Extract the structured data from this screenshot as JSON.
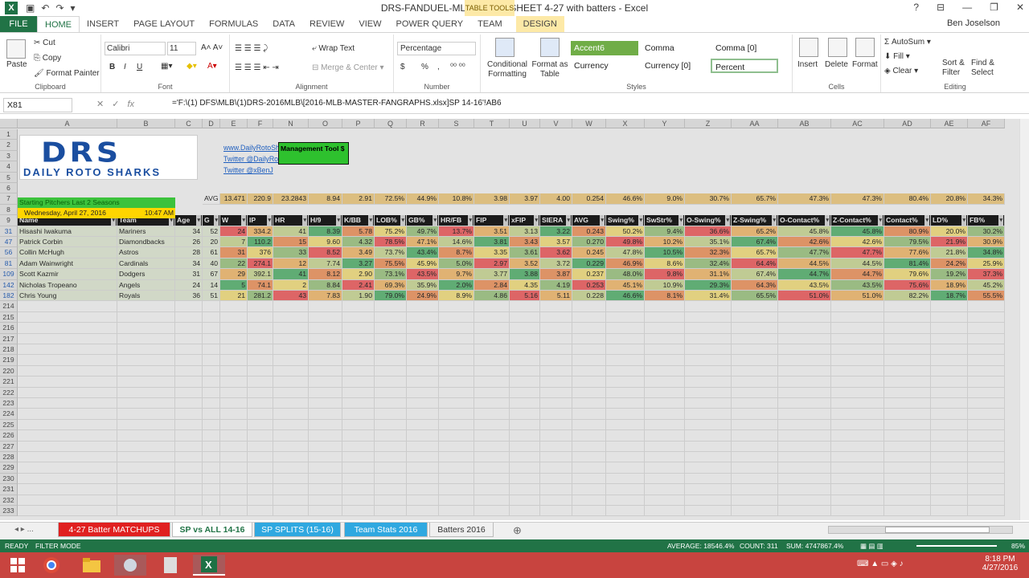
{
  "window": {
    "title": "DRS-FANDUEL-MLB-CHEAT-SHEET 4-27 with batters - Excel",
    "table_tools": "TABLE TOOLS",
    "user": "Ben Joselson",
    "controls": [
      "?",
      "⊟",
      "—",
      "❐",
      "✕"
    ]
  },
  "ribbon_tabs": [
    "FILE",
    "HOME",
    "INSERT",
    "PAGE LAYOUT",
    "FORMULAS",
    "DATA",
    "REVIEW",
    "VIEW",
    "POWER QUERY",
    "TEAM",
    "DESIGN"
  ],
  "clipboard": {
    "paste": "Paste",
    "cut": "Cut",
    "copy": "Copy",
    "format_painter": "Format Painter",
    "label": "Clipboard"
  },
  "font": {
    "name": "Calibri",
    "size": "11",
    "label": "Font",
    "bold": "B",
    "italic": "I",
    "underline": "U"
  },
  "alignment": {
    "wrap": "Wrap Text",
    "merge": "Merge & Center",
    "label": "Alignment"
  },
  "number": {
    "format": "Percentage",
    "label": "Number",
    "currency": "$",
    "percent": "%",
    "comma": ","
  },
  "styles": {
    "conditional": "Conditional Formatting",
    "format_as_table": "Format as Table",
    "cells": [
      "Accent6",
      "Comma",
      "Comma [0]",
      "Currency",
      "Currency [0]",
      "Percent"
    ],
    "label": "Styles"
  },
  "cells_group": {
    "insert": "Insert",
    "delete": "Delete",
    "format": "Format",
    "label": "Cells"
  },
  "editing": {
    "autosum": "AutoSum",
    "fill": "Fill",
    "clear": "Clear",
    "sort": "Sort & Filter",
    "find": "Find & Select",
    "label": "Editing"
  },
  "formula_bar": {
    "name_box": "X81",
    "fx": "fx",
    "formula": "='F:\\(1) DFS\\MLB\\(1)DRS-2016MLB\\[2016-MLB-MASTER-FANGRAPHS.xlsx]SP 14-16'!AB6"
  },
  "columns": [
    "A",
    "B",
    "C",
    "D",
    "E",
    "F",
    "N",
    "O",
    "P",
    "Q",
    "R",
    "S",
    "T",
    "U",
    "V",
    "W",
    "X",
    "Y",
    "Z",
    "AA",
    "AB",
    "AC",
    "AD",
    "AE",
    "AF"
  ],
  "logo": {
    "big": "DRS",
    "sub": "DAILY ROTO SHARKS"
  },
  "links": [
    "www.DailyRotoSharks.com",
    "Twitter @DailyRotoSharks",
    "Twitter @xBenJ"
  ],
  "mgmt": "Management Tool $",
  "green_bar": "Starting Pitchers Last 2 Seasons",
  "date": {
    "day": "Wednesday, April 27, 2016",
    "time": "10:47 AM"
  },
  "avg_label": "AVG",
  "avg_values": [
    "13.471",
    "220.9",
    "23.2843",
    "8.94",
    "2.91",
    "72.5%",
    "44.9%",
    "10.8%",
    "3.98",
    "3.97",
    "4.00",
    "0.254",
    "46.6%",
    "9.0%",
    "30.7%",
    "65.7%",
    "47.3%",
    "47.3%",
    "80.4%",
    "20.8%",
    "34.3%"
  ],
  "headers": [
    "Name",
    "Team",
    "Age",
    "G",
    "W",
    "IP",
    "HR",
    "H/9",
    "K/BB",
    "LOB%",
    "GB%",
    "HR/FB",
    "FIP",
    "xFIP",
    "SIERA",
    "AVG",
    "Swing%",
    "SwStr%",
    "O-Swing%",
    "Z-Swing%",
    "O-Contact%",
    "Z-Contact%",
    "Contact%",
    "LD%",
    "FB%"
  ],
  "rows": [
    {
      "rn": "31",
      "cells": [
        "Hisashi Iwakuma",
        "Mariners",
        "34",
        "52",
        "24",
        "334.2",
        "41",
        "8.39",
        "5.78",
        "75.2%",
        "49.7%",
        "13.7%",
        "3.51",
        "3.13",
        "3.22",
        "0.243",
        "50.2%",
        "9.4%",
        "36.6%",
        "65.2%",
        "45.8%",
        "45.8%",
        "80.9%",
        "20.0%",
        "30.2%"
      ]
    },
    {
      "rn": "47",
      "cells": [
        "Patrick Corbin",
        "Diamondbacks",
        "26",
        "20",
        "7",
        "110.2",
        "15",
        "9.60",
        "4.32",
        "78.5%",
        "47.1%",
        "14.6%",
        "3.81",
        "3.43",
        "3.57",
        "0.270",
        "49.8%",
        "10.2%",
        "35.1%",
        "67.4%",
        "42.6%",
        "42.6%",
        "79.5%",
        "21.9%",
        "30.9%"
      ]
    },
    {
      "rn": "56",
      "cells": [
        "Collin McHugh",
        "Astros",
        "28",
        "61",
        "31",
        "376",
        "33",
        "8.52",
        "3.49",
        "73.7%",
        "43.4%",
        "8.7%",
        "3.35",
        "3.61",
        "3.62",
        "0.245",
        "47.8%",
        "10.5%",
        "32.3%",
        "65.7%",
        "47.7%",
        "47.7%",
        "77.6%",
        "21.8%",
        "34.8%"
      ]
    },
    {
      "rn": "81",
      "cells": [
        "Adam Wainwright",
        "Cardinals",
        "34",
        "40",
        "22",
        "274.1",
        "12",
        "7.74",
        "3.27",
        "75.5%",
        "45.9%",
        "5.0%",
        "2.97",
        "3.52",
        "3.72",
        "0.229",
        "46.9%",
        "8.6%",
        "32.4%",
        "64.4%",
        "44.5%",
        "44.5%",
        "81.4%",
        "24.2%",
        "25.9%"
      ]
    },
    {
      "rn": "109",
      "cells": [
        "Scott Kazmir",
        "Dodgers",
        "31",
        "67",
        "29",
        "392.1",
        "41",
        "8.12",
        "2.90",
        "73.1%",
        "43.5%",
        "9.7%",
        "3.77",
        "3.88",
        "3.87",
        "0.237",
        "48.0%",
        "9.8%",
        "31.1%",
        "67.4%",
        "44.7%",
        "44.7%",
        "79.6%",
        "19.2%",
        "37.3%"
      ]
    },
    {
      "rn": "142",
      "cells": [
        "Nicholas Tropeano",
        "Angels",
        "24",
        "14",
        "5",
        "74.1",
        "2",
        "8.84",
        "2.41",
        "69.3%",
        "35.9%",
        "2.0%",
        "2.84",
        "4.35",
        "4.19",
        "0.253",
        "45.1%",
        "10.9%",
        "29.3%",
        "64.3%",
        "43.5%",
        "43.5%",
        "75.6%",
        "18.9%",
        "45.2%"
      ]
    },
    {
      "rn": "182",
      "cells": [
        "Chris Young",
        "Royals",
        "36",
        "51",
        "21",
        "281.2",
        "43",
        "7.83",
        "1.90",
        "79.0%",
        "24.9%",
        "8.9%",
        "4.86",
        "5.16",
        "5.11",
        "0.228",
        "46.6%",
        "8.1%",
        "31.4%",
        "65.5%",
        "51.0%",
        "51.0%",
        "82.2%",
        "18.7%",
        "55.5%"
      ]
    }
  ],
  "empty_rows": [
    "214",
    "215",
    "216",
    "217",
    "218",
    "219",
    "220",
    "221",
    "222",
    "223",
    "224",
    "225",
    "226",
    "227",
    "228",
    "229",
    "230",
    "231",
    "232",
    "233"
  ],
  "sheet_tabs": [
    "4-27 Batter MATCHUPS",
    "SP vs ALL 14-16",
    "SP SPLITS (15-16)",
    "Team Stats 2016",
    "Batters 2016"
  ],
  "status": {
    "ready": "READY",
    "mode": "FILTER MODE",
    "average": "AVERAGE: 18546.4%",
    "count": "COUNT: 311",
    "sum": "SUM: 4747867.4%",
    "zoom": "85%"
  },
  "clock": {
    "time": "8:18 PM",
    "date": "4/27/2016"
  }
}
